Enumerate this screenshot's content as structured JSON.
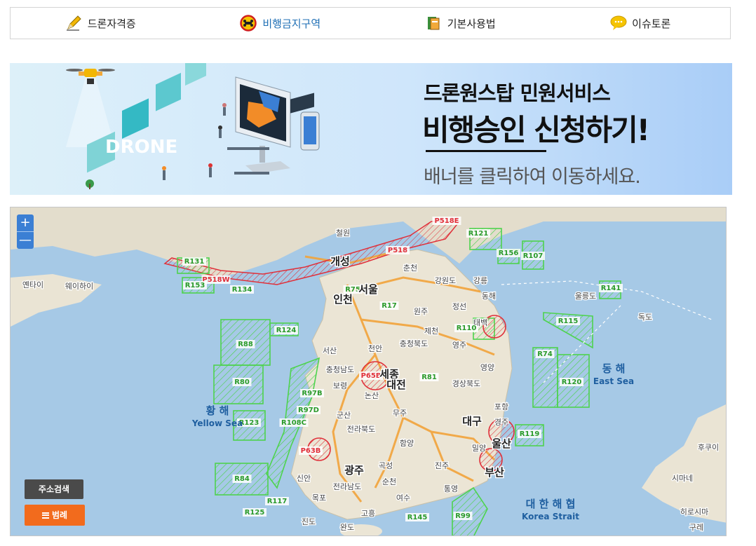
{
  "nav": {
    "items": [
      {
        "label": "드론자격증",
        "icon": "pencil-icon"
      },
      {
        "label": "비행금지구역",
        "icon": "no-drone-icon",
        "active": true
      },
      {
        "label": "기본사용법",
        "icon": "book-icon"
      },
      {
        "label": "이슈토론",
        "icon": "speech-bubble-icon"
      }
    ]
  },
  "banner": {
    "line1": "드론원스탑 민원서비스",
    "line2": "비행승인 신청하기!",
    "line3": "배너를 클릭하여 이동하세요.",
    "art_text": "DRONE"
  },
  "map": {
    "zoom_in": "+",
    "zoom_out": "—",
    "search_label": "주소검색",
    "legend_label": "범례",
    "colors": {
      "sea": "#a4c8e6",
      "land": "#ece6d8",
      "restricted": "#4ed34e",
      "prohibited": "#e0303a",
      "road": "#f2a33a"
    },
    "sea_labels": {
      "yellow_ko": "황 해",
      "yellow_en": "Yellow Sea",
      "east_ko": "동 해",
      "east_en": "East Sea",
      "strait_ko": "대 한 해 협",
      "strait_en": "Korea Strait"
    },
    "places": [
      "개성",
      "철원",
      "춘천",
      "서울",
      "인천",
      "원주",
      "강원도",
      "강릉",
      "동해",
      "울릉도",
      "독도",
      "정선",
      "태백",
      "제천",
      "영주",
      "충청북도",
      "세종",
      "대전",
      "천안",
      "서산",
      "보령",
      "논산",
      "군산",
      "충청남도",
      "전라북도",
      "무주",
      "경상북도",
      "대구",
      "포항",
      "경주",
      "울산",
      "밀양",
      "부산",
      "진주",
      "통영",
      "여수",
      "순천",
      "광주",
      "전라남도",
      "목포",
      "고흥",
      "완도",
      "진도",
      "신안",
      "곡성",
      "함양",
      "영양",
      "웨이하이",
      "옌타이",
      "후쿠이",
      "시마네",
      "히로시마",
      "구레"
    ],
    "zones": {
      "prohibited": [
        "P518",
        "P518E",
        "P518W",
        "P65B",
        "P63B"
      ],
      "restricted": [
        "R121",
        "R156",
        "R107",
        "R131",
        "R153",
        "R134",
        "R75",
        "R17",
        "R110",
        "R115",
        "R141",
        "R124",
        "R88",
        "R80",
        "R97B",
        "R97D",
        "R108C",
        "R123",
        "R84",
        "R117",
        "R125",
        "R81",
        "R74",
        "R120",
        "R119",
        "R145",
        "R99"
      ]
    }
  }
}
